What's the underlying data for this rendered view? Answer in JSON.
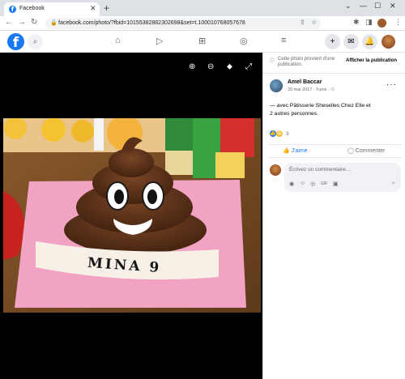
{
  "browser": {
    "tab_title": "Facebook",
    "tab_favicon": "f",
    "tab_close": "✕",
    "new_tab": "+",
    "window_controls": [
      "⌄",
      "—",
      "☐",
      "✕"
    ],
    "nav": {
      "back": "←",
      "forward": "→",
      "reload": "↻"
    },
    "url": "facebook.com/photo/?fbid=10155382882302698&set=t.100010768057678",
    "lock_icon": "🔒",
    "omnibox_icons": [
      "⇪",
      "☆"
    ],
    "extensions": [
      "✱",
      "◨"
    ],
    "menu": "⋮"
  },
  "fb_nav": {
    "logo": "f",
    "search_icon": "⌕",
    "center_icons": [
      "⌂",
      "▷",
      "⊞",
      "◎",
      "≡"
    ],
    "right_buttons": [
      "+",
      "✉",
      "🔔"
    ]
  },
  "viewer": {
    "tools": [
      "⊕",
      "⊖",
      "⬥",
      "⤢"
    ],
    "name_on_cake": "MINA 9"
  },
  "post": {
    "notice": "Cette photo provient d'une publication.",
    "notice_icon": "ⓘ",
    "show_publication": "Afficher la publication",
    "author": "Amel Baccar",
    "meta": "20 mai 2017 · Tunis · ⚇",
    "more": "···",
    "text_line1": "— avec Pâtisserie Sheselles Chez Elle et",
    "text_line2": "2 autres personnes.",
    "reactions": {
      "like": "👍",
      "haha": "😆",
      "count": "3"
    },
    "like_label": "J'aime",
    "like_icon": "👍",
    "comment_label": "Commenter",
    "comment_icon": "◯",
    "comment_placeholder": "Écrivez un commentaire…",
    "comment_tools": [
      "◉",
      "☺",
      "◎",
      "GIF",
      "▣"
    ],
    "send_icon": "➤"
  },
  "colors": {
    "brand": "#1877f2",
    "viewer_bg": "#000000",
    "cake_board": "#f2a2c3",
    "cake_chocolate": "#5a3018"
  }
}
